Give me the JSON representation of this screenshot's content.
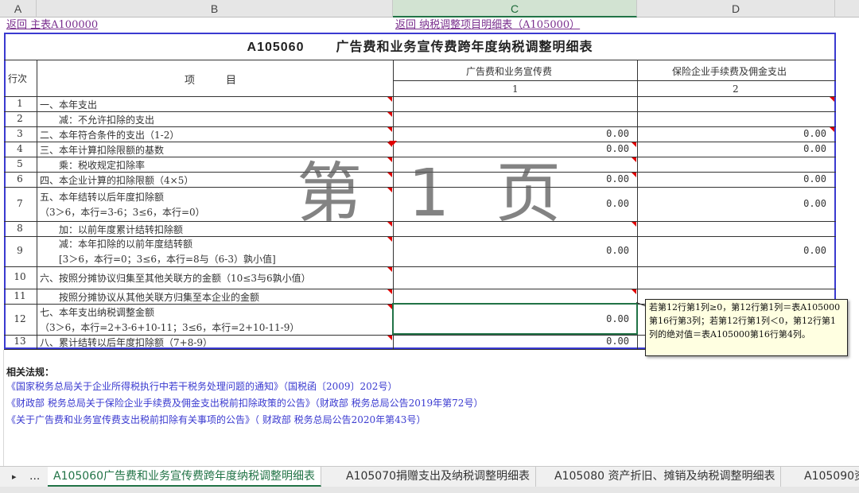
{
  "columns": [
    "A",
    "B",
    "C",
    "D"
  ],
  "links": {
    "back_main": "返回  主表A100000",
    "back_detail": "返回   纳税调整项目明细表（A105000）"
  },
  "form": {
    "code": "A105060",
    "title": "广告费和业务宣传费跨年度纳税调整明细表",
    "header_row_no": "行次",
    "header_item": "项　　　目",
    "header_col1": "广告费和业务宣传费",
    "header_col2": "保险企业手续费及佣金支出",
    "col1_no": "1",
    "col2_no": "2"
  },
  "rows": [
    {
      "no": "1",
      "item": "一、本年支出",
      "c1": "",
      "c2": ""
    },
    {
      "no": "2",
      "item": "　　减：不允许扣除的支出",
      "c1": "",
      "c2": ""
    },
    {
      "no": "3",
      "item": "二、本年符合条件的支出（1-2）",
      "c1": "0.00",
      "c2": "0.00"
    },
    {
      "no": "4",
      "item": "三、本年计算扣除限额的基数",
      "c1": "0.00",
      "c2": "0.00"
    },
    {
      "no": "5",
      "item": "　　乘：税收规定扣除率",
      "c1": "",
      "c2": ""
    },
    {
      "no": "6",
      "item": "四、本企业计算的扣除限额（4×5）",
      "c1": "0.00",
      "c2": "0.00"
    },
    {
      "no": "7",
      "item": "五、本年结转以后年度扣除额",
      "item2": "（3＞6，本行=3-6；3≤6，本行=0）",
      "c1": "0.00",
      "c2": "0.00"
    },
    {
      "no": "8",
      "item": "　　加：以前年度累计结转扣除额",
      "c1": "",
      "c2": ""
    },
    {
      "no": "9",
      "item": "　　减：本年扣除的以前年度结转额",
      "item2": "　　[3＞6，本行=0；3≤6，本行=8与（6-3）孰小值]",
      "c1": "0.00",
      "c2": "0.00"
    },
    {
      "no": "10",
      "item": "六、按照分摊协议归集至其他关联方的金额（10≤3与6孰小值）",
      "c1": "",
      "c2": ""
    },
    {
      "no": "11",
      "item": "　　按照分摊协议从其他关联方归集至本企业的金额",
      "c1": "",
      "c2": ""
    },
    {
      "no": "12",
      "item": "七、本年支出纳税调整金额",
      "item2": "（3＞6，本行=2+3-6+10-11；3≤6，本行=2+10-11-9）",
      "c1": "0.00",
      "c2": ""
    },
    {
      "no": "13",
      "item": "八、累计结转以后年度扣除额（7+8-9）",
      "c1": "0.00",
      "c2": ""
    }
  ],
  "watermark": "第 1 页",
  "comment": "若第12行第1列≥0，第12行第1列＝表A105000第16行第3列；若第12行第1列＜0，第12行第1列的绝对值＝表A105000第16行第4列。",
  "laws": {
    "title": "相关法规：",
    "items": [
      "《国家税务总局关于企业所得税执行中若干税务处理问题的通知》（国税函〔2009〕202号）",
      "《财政部 税务总局关于保险企业手续费及佣金支出税前扣除政策的公告》（财政部 税务总局公告2019年第72号）",
      "《关于广告费和业务宣传费支出税前扣除有关事项的公告》（ 财政部 税务总局公告2020年第43号）"
    ]
  },
  "tabs": {
    "nav_prev": "▸",
    "nav_more": "...",
    "items": [
      "A105060广告费和业务宣传费跨年度纳税调整明细表",
      "A105070捐赠支出及纳税调整明细表",
      "A105080 资产折旧、摊销及纳税调整明细表",
      "A105090资"
    ]
  },
  "colors": {
    "accent": "#217346",
    "link": "#7a2f8e",
    "frame": "#3a3ad0",
    "marker": "#e00000"
  }
}
